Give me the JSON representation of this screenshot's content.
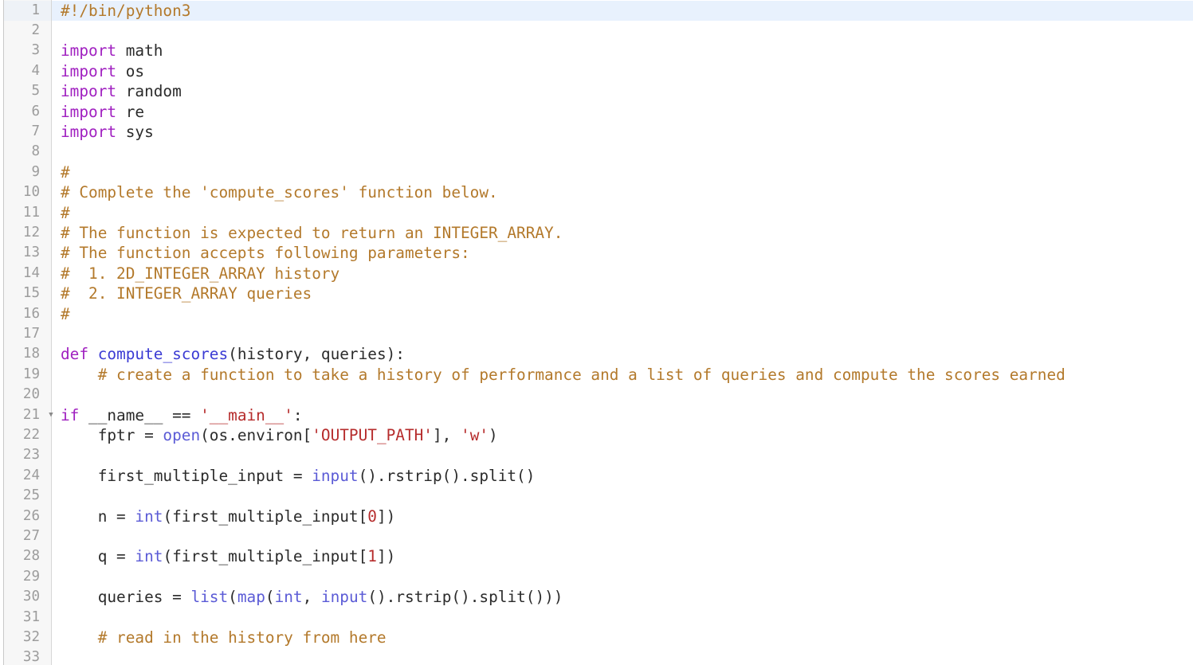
{
  "editor": {
    "language": "python",
    "active_line": 1,
    "first_visible_line": 1,
    "last_visible_line": 33,
    "colors": {
      "background": "#ffffff",
      "gutter_background": "#f7f7f7",
      "active_line_highlight": "#e8f1fd",
      "line_number": "#9c9c9c",
      "comment": "#b3792b",
      "keyword": "#a020c0",
      "function_name": "#3b3bd4",
      "builtin": "#5b5bd6",
      "string": "#b62c2c",
      "number": "#b62c2c",
      "plain_text": "#2b2b2b",
      "gutter_rule": "#d6d6d6"
    }
  },
  "lines": [
    {
      "number": "1",
      "fold": "",
      "active": true,
      "tokens": [
        {
          "t": "#!/bin/python3",
          "c": "t-com"
        }
      ]
    },
    {
      "number": "2",
      "fold": "",
      "active": false,
      "tokens": []
    },
    {
      "number": "3",
      "fold": "",
      "active": false,
      "tokens": [
        {
          "t": "import",
          "c": "t-kw"
        },
        {
          "t": " math",
          "c": "t-pln"
        }
      ]
    },
    {
      "number": "4",
      "fold": "",
      "active": false,
      "tokens": [
        {
          "t": "import",
          "c": "t-kw"
        },
        {
          "t": " os",
          "c": "t-pln"
        }
      ]
    },
    {
      "number": "5",
      "fold": "",
      "active": false,
      "tokens": [
        {
          "t": "import",
          "c": "t-kw"
        },
        {
          "t": " random",
          "c": "t-pln"
        }
      ]
    },
    {
      "number": "6",
      "fold": "",
      "active": false,
      "tokens": [
        {
          "t": "import",
          "c": "t-kw"
        },
        {
          "t": " re",
          "c": "t-pln"
        }
      ]
    },
    {
      "number": "7",
      "fold": "",
      "active": false,
      "tokens": [
        {
          "t": "import",
          "c": "t-kw"
        },
        {
          "t": " sys",
          "c": "t-pln"
        }
      ]
    },
    {
      "number": "8",
      "fold": "",
      "active": false,
      "tokens": []
    },
    {
      "number": "9",
      "fold": "",
      "active": false,
      "tokens": [
        {
          "t": "#",
          "c": "t-com"
        }
      ]
    },
    {
      "number": "10",
      "fold": "",
      "active": false,
      "tokens": [
        {
          "t": "# Complete the 'compute_scores' function below.",
          "c": "t-com"
        }
      ]
    },
    {
      "number": "11",
      "fold": "",
      "active": false,
      "tokens": [
        {
          "t": "#",
          "c": "t-com"
        }
      ]
    },
    {
      "number": "12",
      "fold": "",
      "active": false,
      "tokens": [
        {
          "t": "# The function is expected to return an INTEGER_ARRAY.",
          "c": "t-com"
        }
      ]
    },
    {
      "number": "13",
      "fold": "",
      "active": false,
      "tokens": [
        {
          "t": "# The function accepts following parameters:",
          "c": "t-com"
        }
      ]
    },
    {
      "number": "14",
      "fold": "",
      "active": false,
      "tokens": [
        {
          "t": "#  1. 2D_INTEGER_ARRAY history",
          "c": "t-com"
        }
      ]
    },
    {
      "number": "15",
      "fold": "",
      "active": false,
      "tokens": [
        {
          "t": "#  2. INTEGER_ARRAY queries",
          "c": "t-com"
        }
      ]
    },
    {
      "number": "16",
      "fold": "",
      "active": false,
      "tokens": [
        {
          "t": "#",
          "c": "t-com"
        }
      ]
    },
    {
      "number": "17",
      "fold": "",
      "active": false,
      "tokens": []
    },
    {
      "number": "18",
      "fold": "",
      "active": false,
      "tokens": [
        {
          "t": "def",
          "c": "t-kw"
        },
        {
          "t": " ",
          "c": "t-pln"
        },
        {
          "t": "compute_scores",
          "c": "t-fn"
        },
        {
          "t": "(history, queries):",
          "c": "t-pln"
        }
      ]
    },
    {
      "number": "19",
      "fold": "",
      "active": false,
      "tokens": [
        {
          "t": "    # create a function to take a history of performance and a list of queries and compute the scores earned",
          "c": "t-com"
        }
      ]
    },
    {
      "number": "20",
      "fold": "",
      "active": false,
      "tokens": []
    },
    {
      "number": "21",
      "fold": "▼",
      "active": false,
      "tokens": [
        {
          "t": "if",
          "c": "t-kw"
        },
        {
          "t": " __name__ == ",
          "c": "t-pln"
        },
        {
          "t": "'__main__'",
          "c": "t-str"
        },
        {
          "t": ":",
          "c": "t-pln"
        }
      ]
    },
    {
      "number": "22",
      "fold": "",
      "active": false,
      "tokens": [
        {
          "t": "    fptr = ",
          "c": "t-pln"
        },
        {
          "t": "open",
          "c": "t-bi"
        },
        {
          "t": "(os.environ[",
          "c": "t-pln"
        },
        {
          "t": "'OUTPUT_PATH'",
          "c": "t-str"
        },
        {
          "t": "], ",
          "c": "t-pln"
        },
        {
          "t": "'w'",
          "c": "t-str"
        },
        {
          "t": ")",
          "c": "t-pln"
        }
      ]
    },
    {
      "number": "23",
      "fold": "",
      "active": false,
      "tokens": []
    },
    {
      "number": "24",
      "fold": "",
      "active": false,
      "tokens": [
        {
          "t": "    first_multiple_input = ",
          "c": "t-pln"
        },
        {
          "t": "input",
          "c": "t-bi"
        },
        {
          "t": "().rstrip().split()",
          "c": "t-pln"
        }
      ]
    },
    {
      "number": "25",
      "fold": "",
      "active": false,
      "tokens": []
    },
    {
      "number": "26",
      "fold": "",
      "active": false,
      "tokens": [
        {
          "t": "    n = ",
          "c": "t-pln"
        },
        {
          "t": "int",
          "c": "t-bi"
        },
        {
          "t": "(first_multiple_input[",
          "c": "t-pln"
        },
        {
          "t": "0",
          "c": "t-num"
        },
        {
          "t": "])",
          "c": "t-pln"
        }
      ]
    },
    {
      "number": "27",
      "fold": "",
      "active": false,
      "tokens": []
    },
    {
      "number": "28",
      "fold": "",
      "active": false,
      "tokens": [
        {
          "t": "    q = ",
          "c": "t-pln"
        },
        {
          "t": "int",
          "c": "t-bi"
        },
        {
          "t": "(first_multiple_input[",
          "c": "t-pln"
        },
        {
          "t": "1",
          "c": "t-num"
        },
        {
          "t": "])",
          "c": "t-pln"
        }
      ]
    },
    {
      "number": "29",
      "fold": "",
      "active": false,
      "tokens": []
    },
    {
      "number": "30",
      "fold": "",
      "active": false,
      "tokens": [
        {
          "t": "    queries = ",
          "c": "t-pln"
        },
        {
          "t": "list",
          "c": "t-bi"
        },
        {
          "t": "(",
          "c": "t-pln"
        },
        {
          "t": "map",
          "c": "t-bi"
        },
        {
          "t": "(",
          "c": "t-pln"
        },
        {
          "t": "int",
          "c": "t-bi"
        },
        {
          "t": ", ",
          "c": "t-pln"
        },
        {
          "t": "input",
          "c": "t-bi"
        },
        {
          "t": "().rstrip().split()))",
          "c": "t-pln"
        }
      ]
    },
    {
      "number": "31",
      "fold": "",
      "active": false,
      "tokens": []
    },
    {
      "number": "32",
      "fold": "",
      "active": false,
      "tokens": [
        {
          "t": "    # read in the history from here",
          "c": "t-com"
        }
      ]
    },
    {
      "number": "33",
      "fold": "",
      "active": false,
      "tokens": []
    }
  ]
}
